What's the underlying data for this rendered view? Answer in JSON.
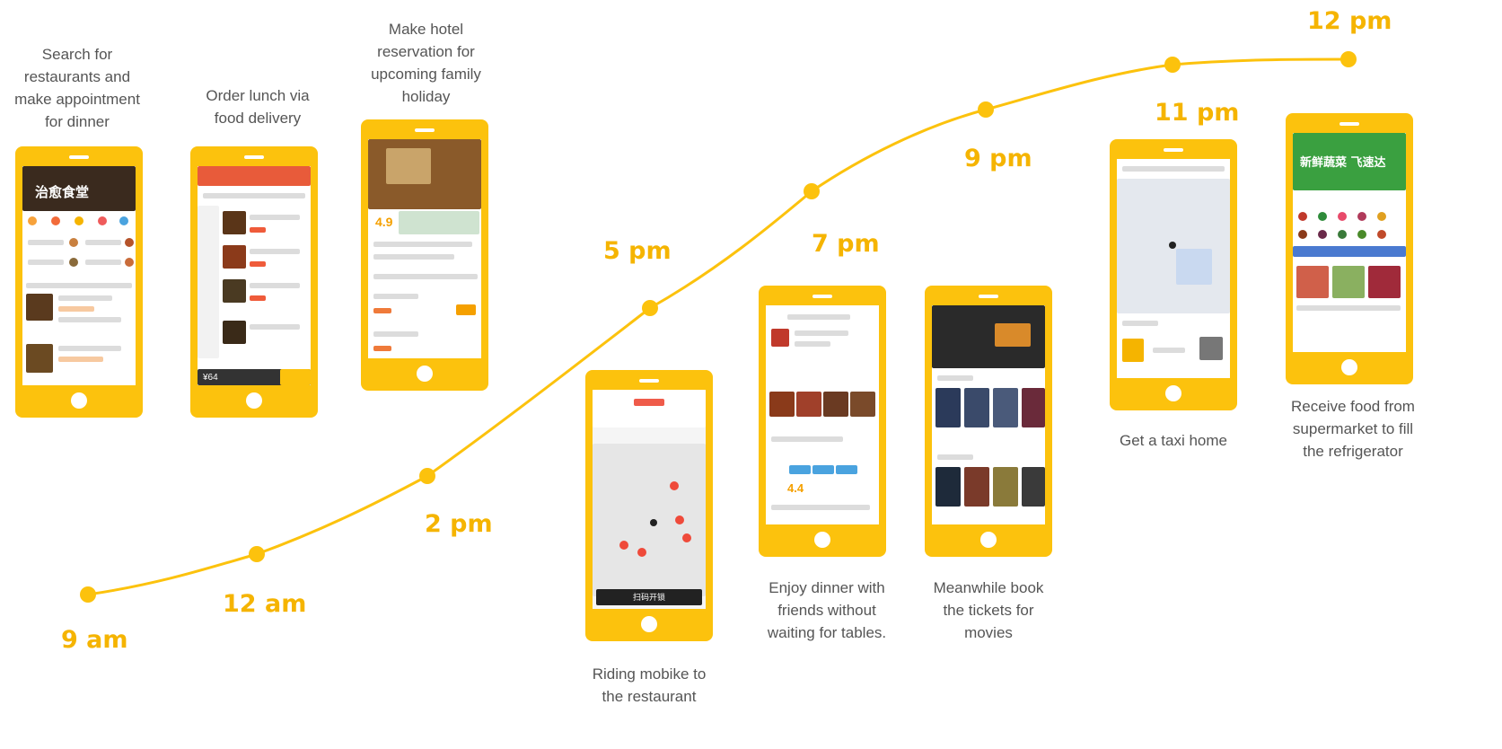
{
  "times": {
    "t9am": "9 am",
    "t12am": "12 am",
    "t2pm": "2 pm",
    "t5pm": "5 pm",
    "t7pm": "7 pm",
    "t9pm": "9 pm",
    "t11pm": "11 pm",
    "t12pm": "12 pm"
  },
  "captions": {
    "search": "Search for restaurants and make appointment for dinner",
    "order": "Order lunch via food delivery",
    "hotel": "Make hotel reservation for upcoming family holiday",
    "mobike": "Riding mobike to the restaurant",
    "dinner": "Enjoy dinner with friends without waiting for tables.",
    "movies": "Meanwhile book the tickets for movies",
    "taxi": "Get a taxi home",
    "grocery": "Receive food from supermarket to fill the refrigerator"
  },
  "screens": {
    "search_banner": "治愈食堂",
    "delivery_total": "¥64",
    "mobike_button": "扫码开锁",
    "hotel_rating": "4.9",
    "dinner_rating": "4.4",
    "grocery_banner": "新鲜蔬菜 飞速达"
  },
  "colors": {
    "accent": "#f5b400",
    "phone": "#fcc20d",
    "line": "#fcc20d"
  }
}
